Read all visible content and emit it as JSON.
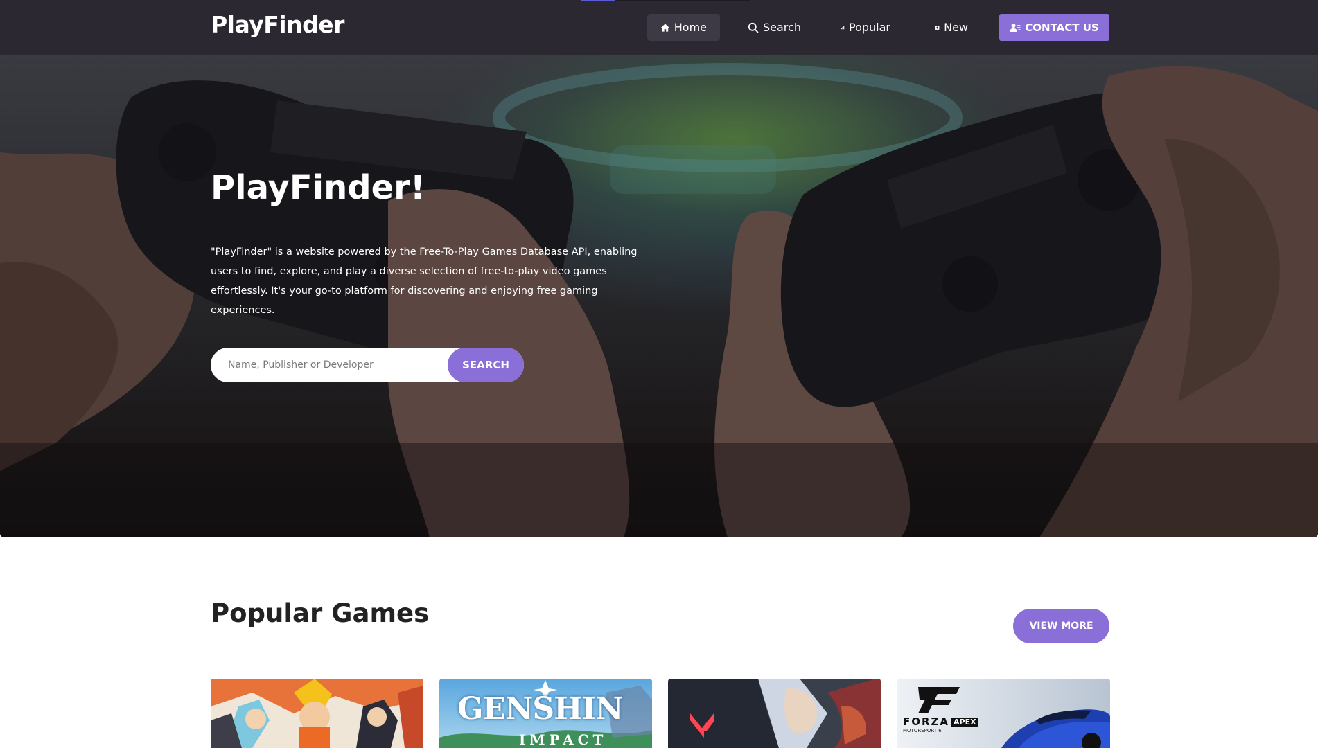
{
  "navbar": {
    "brand": "PlayFinder",
    "items": [
      {
        "label": "Home",
        "icon": "home-icon",
        "active": true
      },
      {
        "label": "Search",
        "icon": "search-icon",
        "active": false
      },
      {
        "label": "Popular",
        "icon": "chart-icon",
        "active": false
      },
      {
        "label": "New",
        "icon": "plus-square-icon",
        "active": false
      }
    ],
    "contact_label": "CONTACT US",
    "contact_icon": "user-contact-icon",
    "background_color": "#2b2832",
    "accent_color": "#8b6fd9"
  },
  "hero": {
    "title": "PlayFinder!",
    "description": "\"PlayFinder\" is a website powered by the Free-To-Play Games Database API, enabling users to find, explore, and play a diverse selection of free-to-play video games effortlessly. It's your go-to platform for discovering and enjoying free gaming experiences.",
    "search": {
      "placeholder": "Name, Publisher or Developer",
      "button_label": "SEARCH"
    }
  },
  "popular": {
    "title": "Popular Games",
    "view_more_label": "VIEW MORE",
    "cards": [
      {
        "art": "naruto-artwork"
      },
      {
        "logo": "GENSHIN",
        "sub": "IMPACT"
      },
      {
        "art": "valorant-artwork"
      },
      {
        "logo": "FORZA",
        "badge": "APEX",
        "sub": "MOTORSPORT 6"
      }
    ]
  }
}
